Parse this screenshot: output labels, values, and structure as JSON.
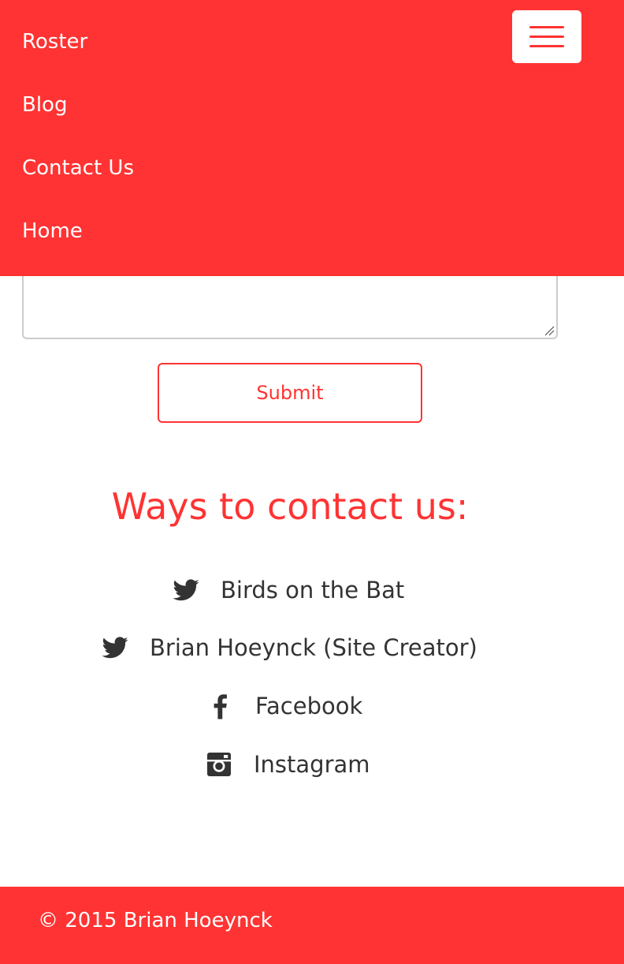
{
  "nav": {
    "items": [
      {
        "label": "Roster"
      },
      {
        "label": "Blog"
      },
      {
        "label": "Contact Us"
      },
      {
        "label": "Home"
      }
    ],
    "toggle_icon": "hamburger-menu-icon"
  },
  "form": {
    "submit_label": "Submit"
  },
  "contact": {
    "heading": "Ways to contact us:",
    "links": [
      {
        "icon": "twitter-icon",
        "label": "Birds on the Bat"
      },
      {
        "icon": "twitter-icon",
        "label": "Brian Hoeynck (Site Creator)"
      },
      {
        "icon": "facebook-icon",
        "label": "Facebook"
      },
      {
        "icon": "instagram-icon",
        "label": "Instagram"
      }
    ]
  },
  "footer": {
    "text": "© 2015 Brian Hoeynck"
  },
  "colors": {
    "accent": "#ff3333",
    "text": "#333333",
    "background": "#ffffff"
  }
}
